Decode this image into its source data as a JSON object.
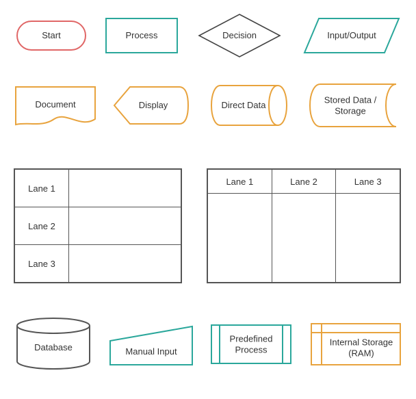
{
  "colors": {
    "red": "#e06666",
    "teal": "#2aa79b",
    "black": "#444444",
    "orange": "#e8a33d",
    "gray": "#555555"
  },
  "shapes": {
    "start": {
      "label": "Start"
    },
    "process": {
      "label": "Process"
    },
    "decision": {
      "label": "Decision"
    },
    "io": {
      "label": "Input/Output"
    },
    "document": {
      "label": "Document"
    },
    "display": {
      "label": "Display"
    },
    "direct_data": {
      "label": "Direct Data"
    },
    "stored_data": {
      "label": "Stored Data / Storage"
    },
    "database": {
      "label": "Database"
    },
    "manual_input": {
      "label": "Manual Input"
    },
    "predefined": {
      "label": "Predefined Process"
    },
    "internal_storage": {
      "label": "Internal Storage (RAM)"
    }
  },
  "swimlanes": {
    "horizontal": {
      "lanes": [
        "Lane 1",
        "Lane 2",
        "Lane 3"
      ]
    },
    "vertical": {
      "lanes": [
        "Lane 1",
        "Lane 2",
        "Lane 3"
      ]
    }
  },
  "chart_data": {
    "type": "table",
    "title": "Flowchart Shape Legend",
    "shapes": [
      {
        "name": "Start",
        "category": "Terminator",
        "color": "red"
      },
      {
        "name": "Process",
        "category": "Process",
        "color": "teal"
      },
      {
        "name": "Decision",
        "category": "Decision",
        "color": "black"
      },
      {
        "name": "Input/Output",
        "category": "Data",
        "color": "teal"
      },
      {
        "name": "Document",
        "category": "Document",
        "color": "orange"
      },
      {
        "name": "Display",
        "category": "Display",
        "color": "orange"
      },
      {
        "name": "Direct Data",
        "category": "Direct Data",
        "color": "orange"
      },
      {
        "name": "Stored Data / Storage",
        "category": "Stored Data",
        "color": "orange"
      },
      {
        "name": "Swimlane (horizontal)",
        "category": "Swimlane",
        "color": "gray",
        "lanes": [
          "Lane 1",
          "Lane 2",
          "Lane 3"
        ]
      },
      {
        "name": "Swimlane (vertical)",
        "category": "Swimlane",
        "color": "gray",
        "lanes": [
          "Lane 1",
          "Lane 2",
          "Lane 3"
        ]
      },
      {
        "name": "Database",
        "category": "Database",
        "color": "gray"
      },
      {
        "name": "Manual Input",
        "category": "Manual Input",
        "color": "teal"
      },
      {
        "name": "Predefined Process",
        "category": "Predefined Process",
        "color": "teal"
      },
      {
        "name": "Internal Storage (RAM)",
        "category": "Internal Storage",
        "color": "orange"
      }
    ]
  }
}
